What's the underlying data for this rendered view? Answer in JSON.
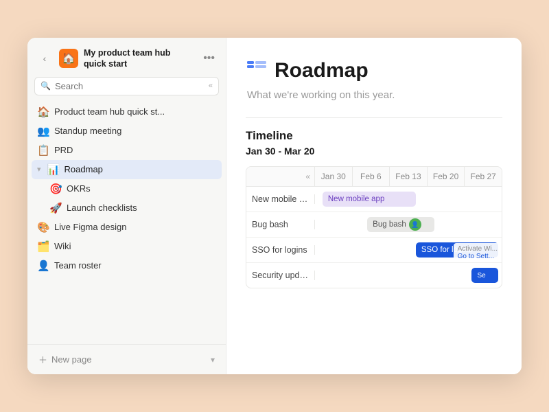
{
  "window": {
    "title": "Roadmap"
  },
  "sidebar": {
    "back_label": "‹",
    "workspace_icon": "🏠",
    "workspace_title": "My product team hub quick start",
    "more_icon": "•••",
    "search_placeholder": "Search",
    "collapse_icon": "«",
    "nav_items": [
      {
        "id": "product-team-hub",
        "icon": "🏠",
        "label": "Product team hub quick st...",
        "active": false,
        "sub": false
      },
      {
        "id": "standup-meeting",
        "icon": "👥",
        "label": "Standup meeting",
        "active": false,
        "sub": false
      },
      {
        "id": "prd",
        "icon": "📋",
        "label": "PRD",
        "active": false,
        "sub": false
      },
      {
        "id": "roadmap",
        "icon": "📊",
        "label": "Roadmap",
        "active": true,
        "sub": false
      },
      {
        "id": "okrs",
        "icon": "🎯",
        "label": "OKRs",
        "active": false,
        "sub": true
      },
      {
        "id": "launch-checklists",
        "icon": "🚀",
        "label": "Launch checklists",
        "active": false,
        "sub": true
      },
      {
        "id": "live-figma-design",
        "icon": "🎨",
        "label": "Live Figma design",
        "active": false,
        "sub": false
      },
      {
        "id": "wiki",
        "icon": "🗂️",
        "label": "Wiki",
        "active": false,
        "sub": false
      },
      {
        "id": "team-roster",
        "icon": "👤",
        "label": "Team roster",
        "active": false,
        "sub": false
      }
    ],
    "new_page_label": "New page"
  },
  "main": {
    "page_subtitle": "What we're working on this year.",
    "page_title": "Roadmap",
    "section_title": "Timeline",
    "date_range": "Jan 30 - Mar 20",
    "timeline_headers": [
      "Jan 30",
      "Feb 6",
      "Feb 13",
      "Feb 20",
      "Feb 27"
    ],
    "timeline_rows": [
      {
        "label": "New mobile app"
      },
      {
        "label": "Bug bash"
      },
      {
        "label": "SSO for logins"
      },
      {
        "label": "Security updates"
      }
    ],
    "bars": [
      {
        "row": 0,
        "text": "New mobile app",
        "style": "purple",
        "left": "5%",
        "width": "48%"
      },
      {
        "row": 1,
        "text": "Bug bash",
        "style": "gray",
        "left": "28%",
        "width": "36%"
      },
      {
        "row": 2,
        "text": "SSO for logins",
        "style": "blue",
        "left": "55%",
        "width": "42%"
      }
    ],
    "activate_text": "Activate W...",
    "go_to_settings": "Go to Sett...",
    "security_label": "Se"
  }
}
